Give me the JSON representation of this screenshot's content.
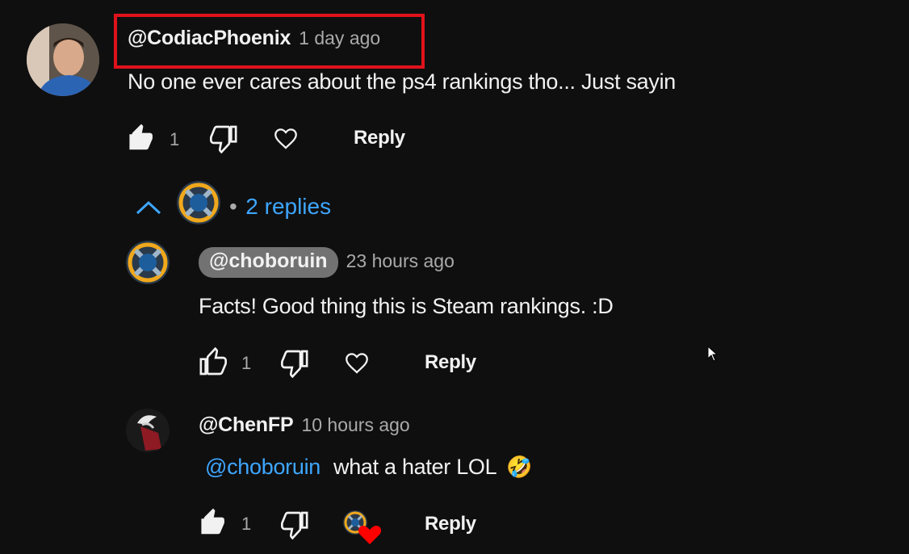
{
  "comment": {
    "author": "@CodiacPhoenix",
    "time": "1 day ago",
    "text": "No one ever cares about the ps4 rankings tho... Just sayin",
    "likes": "1",
    "reply_label": "Reply",
    "replies_label": "2 replies",
    "replies_bullet": "•"
  },
  "replies": [
    {
      "author": "@choboruin",
      "time": "23 hours ago",
      "text": "Facts! Good thing this is Steam rankings. :D",
      "likes": "1",
      "reply_label": "Reply"
    },
    {
      "author": "@ChenFP",
      "time": "10 hours ago",
      "mention": "@choboruin",
      "text": "what a hater LOL",
      "emoji": "🤣",
      "likes": "1",
      "reply_label": "Reply"
    }
  ],
  "colors": {
    "background": "#0f0f0f",
    "link_blue": "#3ea6ff",
    "highlight_red": "#e0121b",
    "heart_red": "#ff0000"
  },
  "icons": [
    "thumbs-up-filled-icon",
    "thumbs-up-outline-icon",
    "thumbs-down-icon",
    "heart-outline-icon",
    "heart-filled-icon",
    "chevron-up-icon"
  ]
}
